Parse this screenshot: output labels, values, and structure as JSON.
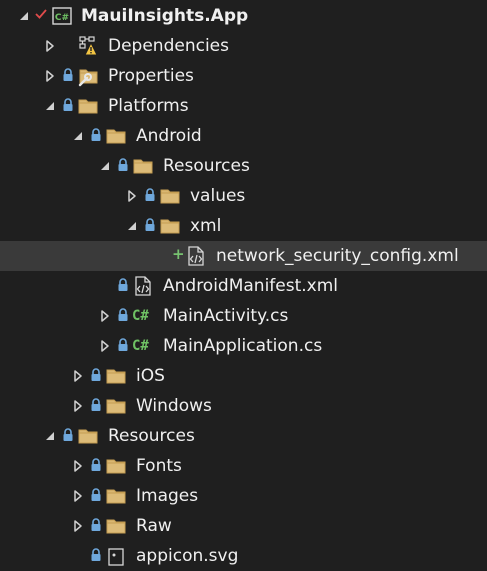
{
  "tree": {
    "project": {
      "label": "MauiInsights.App",
      "icon": "csharp-project-icon",
      "status_icon": "checkmark-icon"
    },
    "items": [
      {
        "label": "Dependencies",
        "icon": "dependencies-warning-icon"
      },
      {
        "label": "Properties",
        "icon": "properties-folder-icon"
      },
      {
        "label": "Platforms",
        "icon": "folder-icon"
      },
      {
        "label": "Android",
        "icon": "folder-icon"
      },
      {
        "label": "Resources",
        "icon": "folder-icon"
      },
      {
        "label": "values",
        "icon": "folder-icon"
      },
      {
        "label": "xml",
        "icon": "folder-icon"
      },
      {
        "label": "network_security_config.xml",
        "icon": "xml-file-icon",
        "status": "+"
      },
      {
        "label": "AndroidManifest.xml",
        "icon": "xml-file-icon"
      },
      {
        "label": "MainActivity.cs",
        "icon": "csharp-file-icon",
        "icon_text": "C#"
      },
      {
        "label": "MainApplication.cs",
        "icon": "csharp-file-icon",
        "icon_text": "C#"
      },
      {
        "label": "iOS",
        "icon": "folder-icon"
      },
      {
        "label": "Windows",
        "icon": "folder-icon"
      },
      {
        "label": "Resources",
        "icon": "folder-icon"
      },
      {
        "label": "Fonts",
        "icon": "folder-icon"
      },
      {
        "label": "Images",
        "icon": "folder-icon"
      },
      {
        "label": "Raw",
        "icon": "folder-icon"
      },
      {
        "label": "appicon.svg",
        "icon": "svg-file-icon"
      }
    ]
  },
  "colors": {
    "background": "#1f1f1f",
    "selected_row": "#3a3a3a",
    "folder": "#d9b671",
    "lock": "#6fa8dc",
    "csharp": "#6fc264",
    "plus": "#77c270",
    "check": "#e04b4b"
  }
}
